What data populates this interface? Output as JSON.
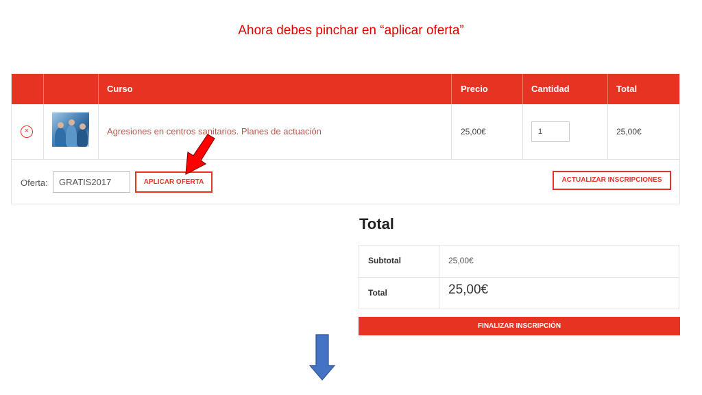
{
  "caption": "Ahora debes pinchar en “aplicar oferta”",
  "cart": {
    "headers": {
      "course": "Curso",
      "price": "Precio",
      "quantity": "Cantidad",
      "total": "Total"
    },
    "item": {
      "remove_glyph": "×",
      "thumbnail_icon": "surgery-photo-icon",
      "name": "Agresiones en centros sanitarios. Planes de actuación",
      "price": "25,00€",
      "quantity": "1",
      "total": "25,00€"
    },
    "coupon": {
      "label": "Oferta:",
      "value": "GRATIS2017",
      "apply_label": "APLICAR OFERTA",
      "update_label": "ACTUALIZAR INSCRIPCIONES"
    }
  },
  "totals": {
    "title": "Total",
    "subtotal_label": "Subtotal",
    "subtotal_value": "25,00€",
    "total_label": "Total",
    "total_value": "25,00€",
    "checkout_label": "FINALIZAR INSCRIPCIÓN"
  },
  "colors": {
    "accent": "#e63322",
    "caption": "#e00000",
    "annotation_red": "#ff0000",
    "annotation_blue": "#4472c4"
  }
}
